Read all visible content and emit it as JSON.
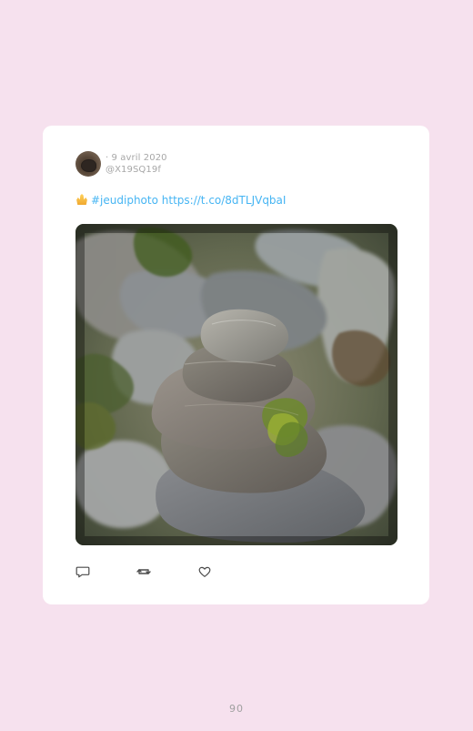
{
  "tweet": {
    "date": "· 9 avril 2020",
    "handle": "@X19SQ19f",
    "text_prefix_emoji": "folded-hands-emoji",
    "hashtag": "#jeudiphoto",
    "link": "https://t.co/8dTLJVqbaI",
    "image_alt": "Stacked stones cairn photo"
  },
  "actions": {
    "reply_icon": "speech-bubble",
    "retweet_icon": "repeat",
    "like_icon": "heart"
  },
  "page": {
    "number": "90"
  },
  "colors": {
    "background": "#f6e1ee",
    "card": "#ffffff",
    "link": "#46b5f3",
    "meta": "#a7a7a7"
  }
}
